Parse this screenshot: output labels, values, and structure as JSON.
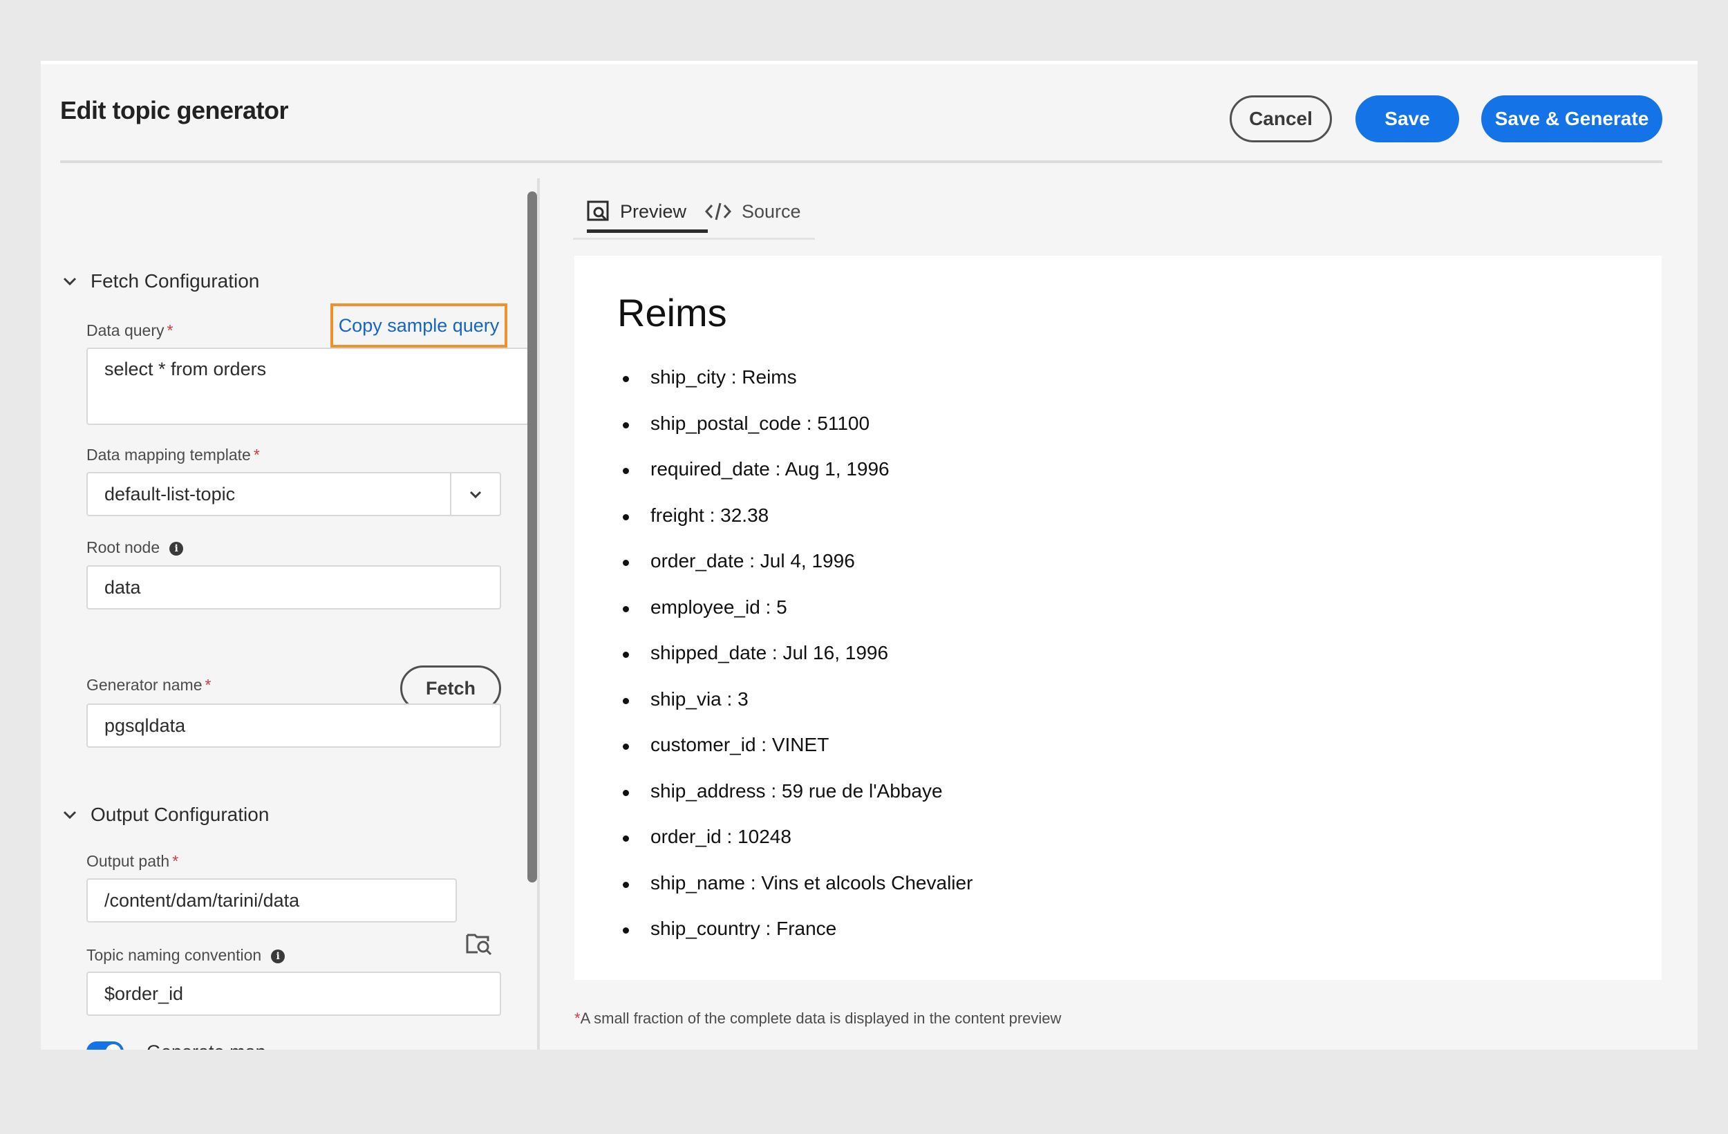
{
  "header": {
    "title": "Edit topic generator",
    "cancel_label": "Cancel",
    "save_label": "Save",
    "save_generate_label": "Save & Generate"
  },
  "fetch_config": {
    "section_title": "Fetch Configuration",
    "data_query_label": "Data query",
    "required_mark": "*",
    "copy_sample_label": "Copy sample query",
    "data_query_value": "select * from orders",
    "mapping_label": "Data mapping template",
    "mapping_value": "default-list-topic",
    "root_node_label": "Root node",
    "root_node_value": "data",
    "fetch_label": "Fetch",
    "generator_name_label": "Generator name",
    "generator_name_value": "pgsqldata"
  },
  "output_config": {
    "section_title": "Output Configuration",
    "output_path_label": "Output path",
    "output_path_value": "/content/dam/tarini/data",
    "naming_label": "Topic naming convention",
    "naming_value": "$order_id",
    "generate_map_label": "Generate map",
    "generate_map_on": true
  },
  "tabs": [
    {
      "label": "Preview",
      "icon": "preview-icon",
      "active": true
    },
    {
      "label": "Source",
      "icon": "code-icon",
      "active": false
    }
  ],
  "preview": {
    "title": "Reims",
    "fields": [
      "ship_city : Reims",
      "ship_postal_code : 51100",
      "required_date : Aug 1, 1996",
      "freight : 32.38",
      "order_date : Jul 4, 1996",
      "employee_id : 5",
      "shipped_date : Jul 16, 1996",
      "ship_via : 3",
      "customer_id : VINET",
      "ship_address : 59 rue de l'Abbaye",
      "order_id : 10248",
      "ship_name : Vins et alcools Chevalier",
      "ship_country : France"
    ],
    "footnote_star": "*",
    "footnote": "A small fraction of the complete data is displayed in the content preview"
  },
  "colors": {
    "accent": "#1473e6",
    "highlight": "#f0922b",
    "required": "#d7373f",
    "link": "#1665c1"
  }
}
